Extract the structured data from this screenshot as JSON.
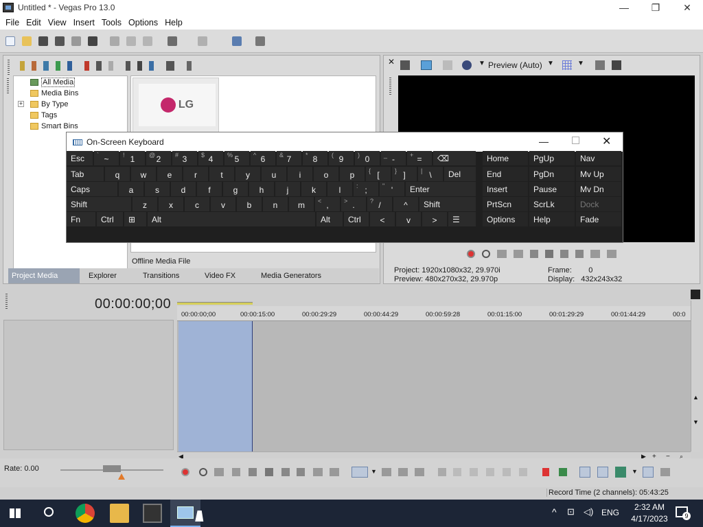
{
  "window": {
    "title": "Untitled * - Vegas Pro 13.0",
    "minimize": "—",
    "maximize": "❐",
    "close": "✕"
  },
  "menu": [
    "File",
    "Edit",
    "View",
    "Insert",
    "Tools",
    "Options",
    "Help"
  ],
  "media_tree": {
    "items": [
      {
        "label": "All Media",
        "expander": ""
      },
      {
        "label": "Media Bins",
        "expander": ""
      },
      {
        "label": "By Type",
        "expander": "+"
      },
      {
        "label": "Tags",
        "expander": ""
      },
      {
        "label": "Smart Bins",
        "expander": ""
      }
    ]
  },
  "thumbnail": {
    "logo_text": "LG",
    "caption": "Offline Media File",
    "partial_left": "20.70",
    "partial_right": "20.70"
  },
  "project_tabs": [
    "Project Media",
    "Explorer",
    "Transitions",
    "Video FX",
    "Media Generators"
  ],
  "preview": {
    "mode_label": "Preview (Auto)",
    "project_label": "Project:",
    "project_value": "1920x1080x32, 29.970i",
    "preview_label": "Preview:",
    "preview_value": "480x270x32, 29.970p",
    "frame_label": "Frame:",
    "frame_value": "0",
    "display_label": "Display:",
    "display_value": "432x243x32"
  },
  "timeline": {
    "timecode": "00:00:00;00",
    "ruler": [
      "00:00:00;00",
      "00:00:15:00",
      "00:00:29:29",
      "00:00:44:29",
      "00:00:59:28",
      "00:01:15:00",
      "00:01:29:29",
      "00:01:44:29",
      "00:0"
    ],
    "rate": "Rate: 0.00",
    "record_time": "Record Time (2 channels): 05:43:25"
  },
  "osk": {
    "title": "On-Screen Keyboard",
    "rows": [
      [
        {
          "m": "Esc",
          "s": ""
        },
        {
          "m": "~",
          "s": "`",
          "sym": true
        },
        {
          "m": "1",
          "s": "!"
        },
        {
          "m": "2",
          "s": "@"
        },
        {
          "m": "3",
          "s": "#"
        },
        {
          "m": "4",
          "s": "$"
        },
        {
          "m": "5",
          "s": "%"
        },
        {
          "m": "6",
          "s": "^"
        },
        {
          "m": "7",
          "s": "&"
        },
        {
          "m": "8",
          "s": "*"
        },
        {
          "m": "9",
          "s": "("
        },
        {
          "m": "0",
          "s": ")"
        },
        {
          "m": "-",
          "s": "_"
        },
        {
          "m": "=",
          "s": "+"
        },
        {
          "m": "⌫",
          "s": ""
        }
      ],
      [
        {
          "m": "Tab",
          "s": ""
        },
        {
          "m": "q",
          "s": ""
        },
        {
          "m": "w",
          "s": ""
        },
        {
          "m": "e",
          "s": ""
        },
        {
          "m": "r",
          "s": ""
        },
        {
          "m": "t",
          "s": ""
        },
        {
          "m": "y",
          "s": ""
        },
        {
          "m": "u",
          "s": ""
        },
        {
          "m": "i",
          "s": ""
        },
        {
          "m": "o",
          "s": ""
        },
        {
          "m": "p",
          "s": ""
        },
        {
          "m": "[",
          "s": "{"
        },
        {
          "m": "]",
          "s": "}"
        },
        {
          "m": "\\",
          "s": "|"
        },
        {
          "m": "Del",
          "s": ""
        }
      ],
      [
        {
          "m": "Caps",
          "s": ""
        },
        {
          "m": "a",
          "s": ""
        },
        {
          "m": "s",
          "s": ""
        },
        {
          "m": "d",
          "s": ""
        },
        {
          "m": "f",
          "s": ""
        },
        {
          "m": "g",
          "s": ""
        },
        {
          "m": "h",
          "s": ""
        },
        {
          "m": "j",
          "s": ""
        },
        {
          "m": "k",
          "s": ""
        },
        {
          "m": "l",
          "s": ""
        },
        {
          "m": ";",
          "s": ":"
        },
        {
          "m": "'",
          "s": "\""
        },
        {
          "m": "Enter",
          "s": ""
        }
      ],
      [
        {
          "m": "Shift",
          "s": ""
        },
        {
          "m": "z",
          "s": ""
        },
        {
          "m": "x",
          "s": ""
        },
        {
          "m": "c",
          "s": ""
        },
        {
          "m": "v",
          "s": ""
        },
        {
          "m": "b",
          "s": ""
        },
        {
          "m": "n",
          "s": ""
        },
        {
          "m": "m",
          "s": ""
        },
        {
          "m": ",",
          "s": "<"
        },
        {
          "m": ".",
          "s": ">"
        },
        {
          "m": "/",
          "s": "?"
        },
        {
          "m": "^",
          "s": ""
        },
        {
          "m": "Shift",
          "s": ""
        }
      ],
      [
        {
          "m": "Fn",
          "s": ""
        },
        {
          "m": "Ctrl",
          "s": ""
        },
        {
          "m": "⊞",
          "s": ""
        },
        {
          "m": "Alt",
          "s": ""
        },
        {
          "m": "",
          "s": ""
        },
        {
          "m": "Alt",
          "s": ""
        },
        {
          "m": "Ctrl",
          "s": ""
        },
        {
          "m": "<",
          "s": ""
        },
        {
          "m": "v",
          "s": ""
        },
        {
          "m": ">",
          "s": ""
        },
        {
          "m": "☰",
          "s": ""
        }
      ]
    ],
    "nav": [
      [
        "Home",
        "PgUp",
        "Nav"
      ],
      [
        "End",
        "PgDn",
        "Mv Up"
      ],
      [
        "Insert",
        "Pause",
        "Mv Dn"
      ],
      [
        "PrtScn",
        "ScrLk",
        "Dock"
      ],
      [
        "Options",
        "Help",
        "Fade"
      ]
    ]
  },
  "taskbar": {
    "lang": "ENG",
    "time": "2:32 AM",
    "date": "4/17/2023",
    "notifications": "9"
  },
  "colors": {
    "accent": "#3a6ea5",
    "selection": "#9fb3d6",
    "osk_bg": "#1f1f1f",
    "taskbar": "#1c2536"
  }
}
